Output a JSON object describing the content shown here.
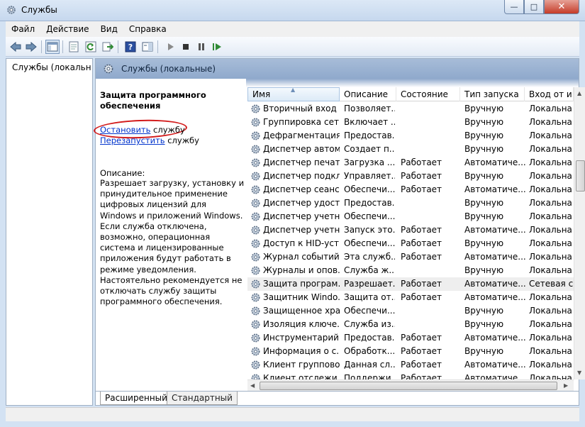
{
  "window": {
    "title": "Службы",
    "min": "—",
    "max": "□",
    "close": "✕"
  },
  "menu": [
    "Файл",
    "Действие",
    "Вид",
    "Справка"
  ],
  "tree": {
    "item": "Службы (локальны"
  },
  "header": {
    "title": "Службы (локальные)"
  },
  "details": {
    "service_title": "Защита программного обеспечения",
    "stop_link": "Остановить",
    "stop_rest": " службу",
    "restart_link": "Перезапустить",
    "restart_rest": " службу",
    "desc_label": "Описание:",
    "desc_text": "Разрешает загрузку, установку и принудительное применение цифровых лицензий для Windows и приложений Windows. Если служба отключена, возможно, операционная система и лицензированные приложения будут работать в режиме уведомления. Настоятельно рекомендуется не отключать службу защиты программного обеспечения."
  },
  "columns": {
    "name": "Имя",
    "desc": "Описание",
    "state": "Состояние",
    "start": "Тип запуска",
    "login": "Вход от и"
  },
  "rows": [
    {
      "name": "Вторичный вход ...",
      "desc": "Позволяет...",
      "state": "",
      "start": "Вручную",
      "login": "Локальна"
    },
    {
      "name": "Группировка сет...",
      "desc": "Включает ...",
      "state": "",
      "start": "Вручную",
      "login": "Локальна"
    },
    {
      "name": "Дефрагментация ...",
      "desc": "Предостав...",
      "state": "",
      "start": "Вручную",
      "login": "Локальна"
    },
    {
      "name": "Диспетчер автом...",
      "desc": "Создает п...",
      "state": "",
      "start": "Вручную",
      "login": "Локальна"
    },
    {
      "name": "Диспетчер печати",
      "desc": "Загрузка ...",
      "state": "Работает",
      "start": "Автоматиче...",
      "login": "Локальна"
    },
    {
      "name": "Диспетчер подкл...",
      "desc": "Управляет...",
      "state": "Работает",
      "start": "Вручную",
      "login": "Локальна"
    },
    {
      "name": "Диспетчер сеанс...",
      "desc": "Обеспечи...",
      "state": "Работает",
      "start": "Автоматиче...",
      "login": "Локальна"
    },
    {
      "name": "Диспетчер удост...",
      "desc": "Предостав...",
      "state": "",
      "start": "Вручную",
      "login": "Локальна"
    },
    {
      "name": "Диспетчер учетн...",
      "desc": "Обеспечи...",
      "state": "",
      "start": "Вручную",
      "login": "Локальна"
    },
    {
      "name": "Диспетчер учетн...",
      "desc": "Запуск это...",
      "state": "Работает",
      "start": "Автоматиче...",
      "login": "Локальна"
    },
    {
      "name": "Доступ к HID-уст...",
      "desc": "Обеспечи...",
      "state": "Работает",
      "start": "Вручную",
      "login": "Локальна"
    },
    {
      "name": "Журнал событий...",
      "desc": "Эта служб...",
      "state": "Работает",
      "start": "Автоматиче...",
      "login": "Локальна"
    },
    {
      "name": "Журналы и опов...",
      "desc": "Служба ж...",
      "state": "",
      "start": "Вручную",
      "login": "Локальна"
    },
    {
      "name": "Защита програм...",
      "desc": "Разрешает...",
      "state": "Работает",
      "start": "Автоматиче...",
      "login": "Сетевая с"
    },
    {
      "name": "Защитник Windo...",
      "desc": "Защита от...",
      "state": "Работает",
      "start": "Автоматиче...",
      "login": "Локальна"
    },
    {
      "name": "Защищенное хра...",
      "desc": "Обеспечи...",
      "state": "",
      "start": "Вручную",
      "login": "Локальна"
    },
    {
      "name": "Изоляция ключе...",
      "desc": "Служба из...",
      "state": "",
      "start": "Вручную",
      "login": "Локальна"
    },
    {
      "name": "Инструментарий ...",
      "desc": "Предостав...",
      "state": "Работает",
      "start": "Автоматиче...",
      "login": "Локальна"
    },
    {
      "name": "Информация о с...",
      "desc": "Обработк...",
      "state": "Работает",
      "start": "Вручную",
      "login": "Локальна"
    },
    {
      "name": "Клиент группово...",
      "desc": "Данная сл...",
      "state": "Работает",
      "start": "Автоматиче...",
      "login": "Локальна"
    },
    {
      "name": "Клиент отслежи...",
      "desc": "Поддержи...",
      "state": "Работает",
      "start": "Автоматиче...",
      "login": "Локальна"
    }
  ],
  "selected_row": 13,
  "tabs": {
    "extended": "Расширенный",
    "standard": "Стандартный"
  },
  "colors": {
    "accent": "#1e4f91",
    "link": "#0033cc",
    "annotation": "#d21a1a"
  }
}
